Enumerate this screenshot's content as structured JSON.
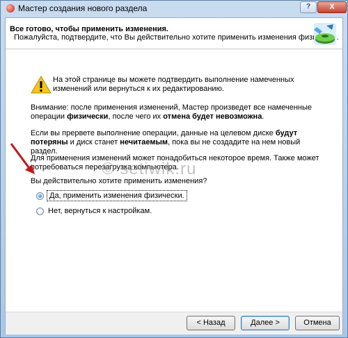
{
  "window": {
    "title": "Мастер создания нового раздела",
    "help_label": "?",
    "close_label": "X"
  },
  "header": {
    "title": "Все готово, чтобы применить изменения.",
    "subtitle": "Пожалуйста, подтвердите, что Вы действительно хотите применить изменения физически."
  },
  "body": {
    "warning_text": "На этой странице вы можете подтвердить выполнение намеченных изменений или вернуться к их редактированию.",
    "p1_a": "Внимание: после применения изменений, Мастер произведет все намеченные операции ",
    "p1_b": "физически",
    "p1_c": ", после чего их ",
    "p1_d": "отмена будет невозможна",
    "p1_e": ".",
    "p2_a": "Если вы прервете выполнение операции, данные на целевом диске ",
    "p2_b": "будут потеряны",
    "p2_c": " и диск станет ",
    "p2_d": "нечитаемым",
    "p2_e": ", пока вы не создадите на нем новый раздел.",
    "p3": "Для применения изменений может понадобиться некоторое время. Также может потребоваться перезагрузка компьютера.",
    "question": "Вы действительно хотите применить изменения?",
    "options": [
      {
        "label": "Да, применить изменения физически.",
        "checked": true
      },
      {
        "label": "Нет, вернуться к настройкам.",
        "checked": false
      }
    ]
  },
  "watermark": "© setiwik.ru",
  "footer": {
    "back_label": "< Назад",
    "next_label": "Далее >",
    "cancel_label": "Отмена"
  }
}
